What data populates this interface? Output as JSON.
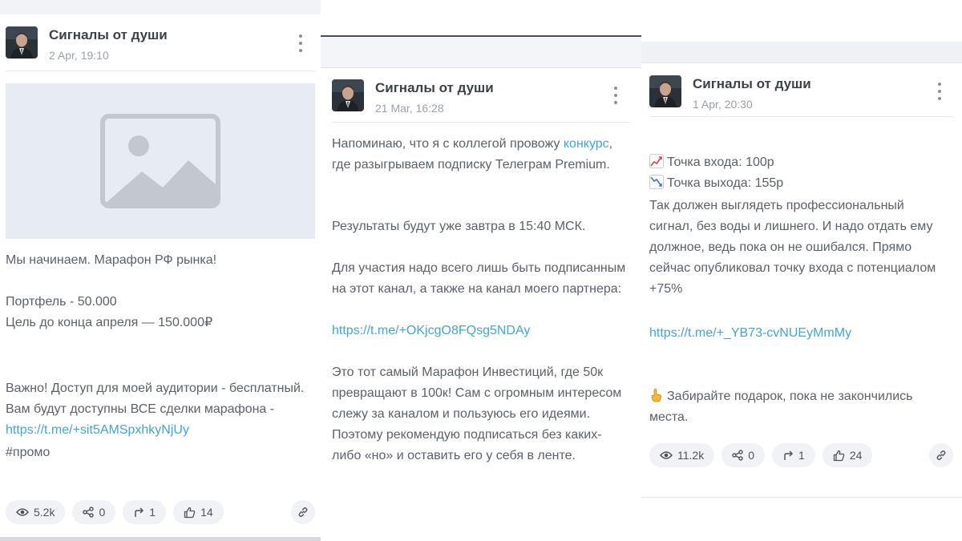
{
  "channel_name": "Сигналы от души",
  "posts": [
    {
      "date": "2 Apr, 19:10",
      "p1": "Мы начинаем. Марафон РФ рынка!",
      "p2": "Портфель - 50.000\nЦель до конца апреля — 150.000₽",
      "p3_text": "Важно! Доступ для моей аудитории - бесплатный. Вам будут доступны ВСЕ сделки марафона - ",
      "p3_link": "https://t.me/+sit5AMSpxhkyNjUy",
      "p4": "#промо",
      "views": "5.2k",
      "shares": "0",
      "forwards": "1",
      "likes": "14"
    },
    {
      "date": "21 Mar, 16:28",
      "p1_a": "Напоминаю, что я с коллегой провожу ",
      "p1_link": "конкурс",
      "p1_b": ", где разыгрываем подписку Телеграм Premium.",
      "p2": "Результаты будут уже завтра в 15:40 МСК.",
      "p3": "Для участия надо всего лишь быть подписанным на этот канал, а также на канал моего партнера:",
      "p3_link": "https://t.me/+OKjcgO8FQsg5NDAy",
      "p4": "Это тот самый Марафон Инвестиций, где 50к превращают в 100к! Сам с огромным интересом слежу за каналом и пользуюсь его идеями. Поэтому рекомендую подписаться без каких-либо «но» и оставить его у себя в ленте."
    },
    {
      "date": "1 Apr, 20:30",
      "entry": "Точка входа: 100р",
      "exit": "Точка выхода: 155р",
      "p2": "Так должен выглядеть профессиональный сигнал, без воды и лишнего. И надо отдать ему должное, ведь пока он не ошибался. Прямо сейчас опубликовал точку входа с потенциалом +75%",
      "p3_link": "https://t.me/+_YB73-cvNUEyMmMy",
      "p4": "Забирайте подарок, пока не закончились места.",
      "views": "11.2k",
      "shares": "0",
      "forwards": "1",
      "likes": "24"
    }
  ],
  "icons": {
    "menu": "more-vertical-icon",
    "views": "eye-icon",
    "shares": "share-icon",
    "forwards": "forward-arrow-icon",
    "likes": "thumbs-up-icon",
    "link": "chain-link-icon",
    "image": "image-placeholder-icon",
    "chart_up": "chart-increasing-emoji",
    "chart_down": "chart-decreasing-emoji",
    "pointing": "pointing-hand-emoji"
  },
  "colors": {
    "link": "#3fa6d6",
    "pill_bg": "#f1f2f5",
    "image_placeholder": "#e7ebf4"
  }
}
